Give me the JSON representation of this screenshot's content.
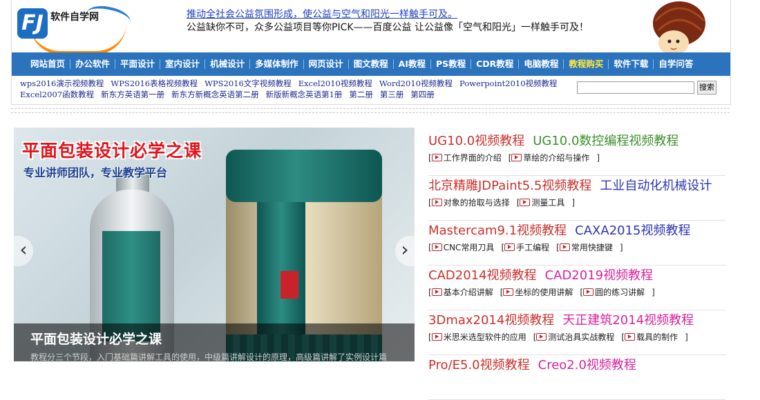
{
  "logo": {
    "text": "软件自学网",
    "mark": "FJ"
  },
  "ad": {
    "link": "推动全社会公益氛围形成，使公益与空气和阳光一样触手可及。",
    "sub": "公益缺你不可，众多公益项目等你PICK——百度公益 让公益像「空气和阳光」一样触手可及！"
  },
  "nav": [
    "网站首页",
    "办公软件",
    "平面设计",
    "室内设计",
    "机械设计",
    "多媒体制作",
    "网页设计",
    "图文教程",
    "AI教程",
    "PS教程",
    "CDR教程",
    "电脑教程",
    "教程购买",
    "软件下载",
    "自学问答"
  ],
  "nav_highlight": "教程购买",
  "sublinks_row1": [
    "wps2016演示视频教程",
    "WPS2016表格视频教程",
    "WPS2016文字视频教程",
    "Excel2010视频教程",
    "Word2010视频教程",
    "Powerpoint2010视频教程"
  ],
  "sublinks_row2": [
    "Excel2007函数教程",
    "新东方英语第一册",
    "新东方新概念英语第二册",
    "新版新概念英语第1册",
    "第二册",
    "第三册",
    "第四册"
  ],
  "search": {
    "button": "搜索",
    "placeholder": ""
  },
  "banner": {
    "title": "平面包装设计必学之课",
    "subtitle": "专业讲师团队，专业教学平台",
    "caption_title": "平面包装设计必学之课",
    "caption_desc": "教程分三个节段，入门基础篇讲解工具的使用，中级篇讲解设计的原理，高级篇讲解了实例设计篇",
    "prev": "‹",
    "next": "›"
  },
  "courses": [
    {
      "titles": [
        {
          "t": "UG10.0视频教程",
          "c": "#c9302c"
        },
        {
          "t": "UG10.0数控编程视频教程",
          "c": "#3a8f2a"
        }
      ],
      "lessons": [
        "工作界面的介绍",
        "草绘的介绍与操作"
      ]
    },
    {
      "titles": [
        {
          "t": "北京精雕JDPaint5.5视频教程",
          "c": "#c9302c"
        },
        {
          "t": "工业自动化机械设计",
          "c": "#2b35b0"
        }
      ],
      "lessons": [
        "对象的拾取与选择",
        "测量工具"
      ]
    },
    {
      "titles": [
        {
          "t": "Mastercam9.1视频教程",
          "c": "#c9302c"
        },
        {
          "t": "CAXA2015视频教程",
          "c": "#2b35b0"
        }
      ],
      "lessons": [
        "CNC常用刀具",
        "手工编程",
        "常用快捷键"
      ]
    },
    {
      "titles": [
        {
          "t": "CAD2014视频教程",
          "c": "#c9302c"
        },
        {
          "t": "CAD2019视频教程",
          "c": "#d6239c"
        }
      ],
      "lessons": [
        "基本介绍讲解",
        "坐标的使用讲解",
        "圆的练习讲解"
      ]
    },
    {
      "titles": [
        {
          "t": "3Dmax2014视频教程",
          "c": "#c9302c"
        },
        {
          "t": "天正建筑2014视频教程",
          "c": "#d6239c"
        }
      ],
      "lessons": [
        "米思米选型软件的应用",
        "测试治具实战教程",
        "载具的制作"
      ]
    },
    {
      "titles": [
        {
          "t": "Pro/E5.0视频教程",
          "c": "#c9302c"
        },
        {
          "t": "Creo2.0视频教程",
          "c": "#d6239c"
        }
      ],
      "lessons": []
    }
  ]
}
